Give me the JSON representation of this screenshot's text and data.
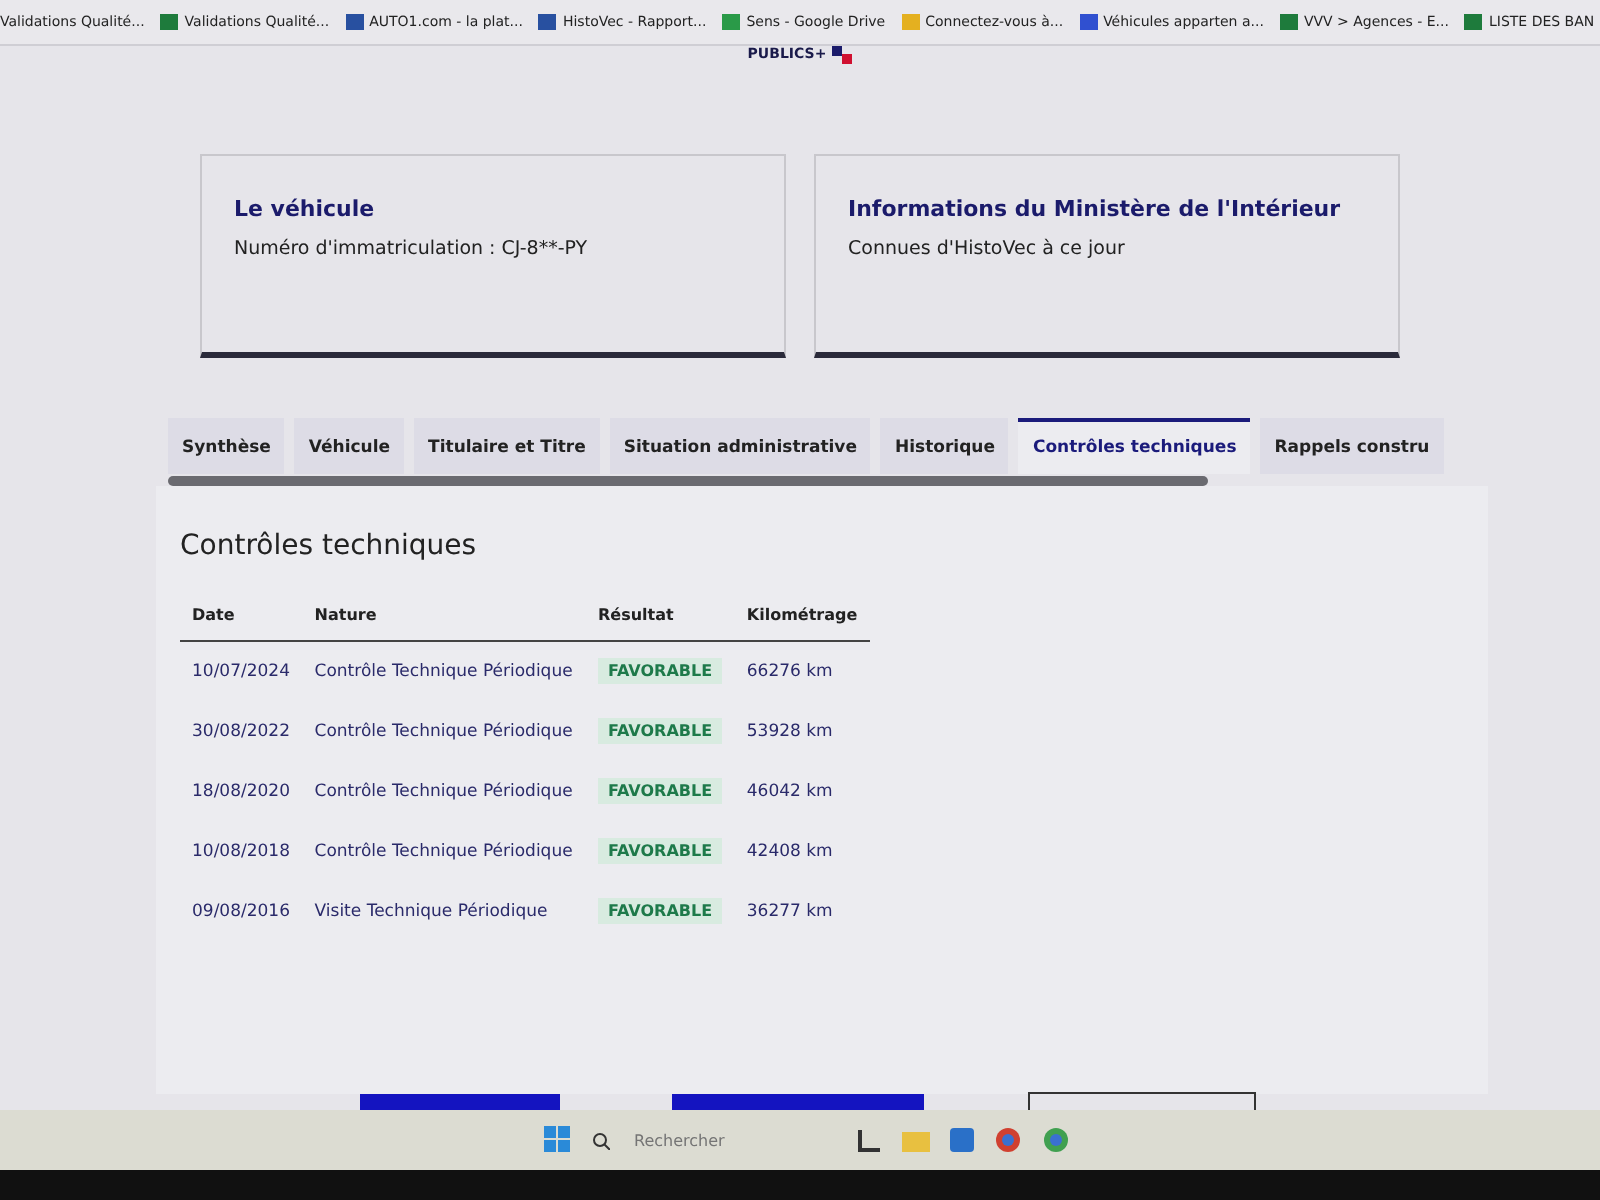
{
  "bookmarks": [
    {
      "label": "Validations Qualité..."
    },
    {
      "label": "Validations Qualité..."
    },
    {
      "label": "AUTO1.com - la plat..."
    },
    {
      "label": "HistoVec - Rapport..."
    },
    {
      "label": "Sens - Google Drive"
    },
    {
      "label": "Connectez-vous à..."
    },
    {
      "label": "Véhicules apparten a..."
    },
    {
      "label": "VVV > Agences - E..."
    },
    {
      "label": "LISTE DES BAN"
    }
  ],
  "logo": {
    "text": "PUBLICS+"
  },
  "cards": [
    {
      "title": "Le véhicule",
      "text": "Numéro d'immatriculation : CJ-8**-PY"
    },
    {
      "title": "Informations du Ministère de l'Intérieur",
      "text": "Connues d'HistoVec à ce jour"
    }
  ],
  "tabs": [
    {
      "label": "Synthèse",
      "selected": false
    },
    {
      "label": "Véhicule",
      "selected": false
    },
    {
      "label": "Titulaire et Titre",
      "selected": false
    },
    {
      "label": "Situation administrative",
      "selected": false
    },
    {
      "label": "Historique",
      "selected": false
    },
    {
      "label": "Contrôles techniques",
      "selected": true
    },
    {
      "label": "Rappels constru",
      "selected": false
    }
  ],
  "section": {
    "title": "Contrôles techniques"
  },
  "table": {
    "columns": [
      "Date",
      "Nature",
      "Résultat",
      "Kilométrage"
    ],
    "rows": [
      {
        "date": "10/07/2024",
        "nature": "Contrôle Technique Périodique",
        "result": "FAVORABLE",
        "mileage": "66276 km"
      },
      {
        "date": "30/08/2022",
        "nature": "Contrôle Technique Périodique",
        "result": "FAVORABLE",
        "mileage": "53928 km"
      },
      {
        "date": "18/08/2020",
        "nature": "Contrôle Technique Périodique",
        "result": "FAVORABLE",
        "mileage": "46042 km"
      },
      {
        "date": "10/08/2018",
        "nature": "Contrôle Technique Périodique",
        "result": "FAVORABLE",
        "mileage": "42408 km"
      },
      {
        "date": "09/08/2016",
        "nature": "Visite Technique Périodique",
        "result": "FAVORABLE",
        "mileage": "36277 km"
      }
    ]
  },
  "taskbar": {
    "search_placeholder": "Rechercher"
  }
}
